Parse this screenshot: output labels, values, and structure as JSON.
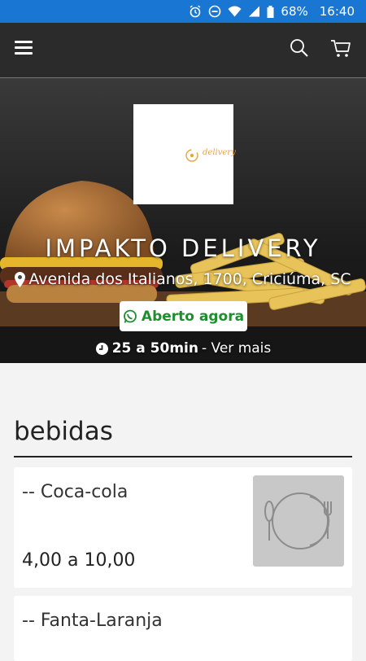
{
  "status_bar": {
    "battery": "68%",
    "time": "16:40",
    "icons": [
      "alarm-icon",
      "do-not-disturb-icon",
      "wifi-icon",
      "signal-icon",
      "battery-icon"
    ]
  },
  "app_bar": {
    "icons": [
      "menu-icon",
      "search-icon",
      "cart-icon"
    ]
  },
  "store": {
    "logo_text": "delivery",
    "name": "IMPAKTO DELIVERY",
    "address": "Avenida dos Italianos, 1700, Criciúma, SC",
    "status": "Aberto agora",
    "delivery_time": "25 a 50min",
    "see_more": "- Ver mais"
  },
  "section": {
    "title": "bebidas"
  },
  "products": [
    {
      "name": "-- Coca-cola",
      "price": "4,00 a 10,00"
    },
    {
      "name": "-- Fanta-Laranja"
    }
  ],
  "colors": {
    "status_bar": "#1976d2",
    "app_bar": "#2b2b2b",
    "open_text": "#1e8e2e",
    "logo_accent": "#e8a53a"
  }
}
